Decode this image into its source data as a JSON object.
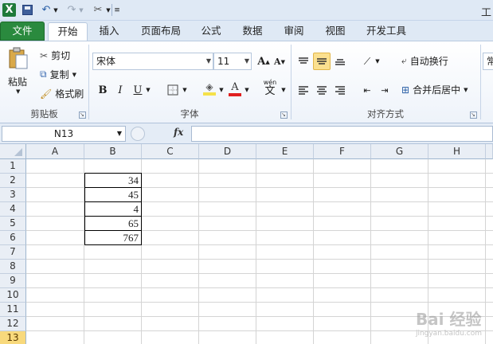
{
  "window": {
    "title": "工"
  },
  "quick_access": {
    "icons": [
      "excel-logo-icon",
      "save-icon",
      "undo-icon",
      "redo-icon",
      "customize-icon"
    ]
  },
  "tabs": [
    "文件",
    "开始",
    "插入",
    "页面布局",
    "公式",
    "数据",
    "审阅",
    "视图",
    "开发工具"
  ],
  "ribbon": {
    "clipboard": {
      "paste": "粘贴",
      "cut": "剪切",
      "copy": "复制",
      "format_painter": "格式刷",
      "label": "剪贴板"
    },
    "font": {
      "font_name": "宋体",
      "font_size": "11",
      "label": "字体",
      "bold": "B",
      "italic": "I",
      "underline": "U",
      "grow": "A",
      "shrink": "A",
      "wen": "wén",
      "wen_char": "文"
    },
    "alignment": {
      "wrap_text": "自动换行",
      "merge_center": "合并后居中",
      "label": "对齐方式"
    },
    "number": {
      "format_partial": "常"
    }
  },
  "formula_bar": {
    "name_box": "N13",
    "fx_label": "fx",
    "formula": ""
  },
  "sheet": {
    "columns": [
      "A",
      "B",
      "C",
      "D",
      "E",
      "F",
      "G",
      "H"
    ],
    "rows": [
      "1",
      "2",
      "3",
      "4",
      "5",
      "6",
      "7",
      "8",
      "9",
      "10",
      "11",
      "12",
      "13"
    ],
    "selected_row": "13",
    "b_values": [
      "34",
      "45",
      "4",
      "65",
      "767"
    ]
  },
  "watermark": {
    "main": "Bai 经验",
    "sub": "jingyan.baidu.com"
  },
  "colors": {
    "file_tab": "#2a8a3e",
    "active_align": "#fbe08f",
    "font_color": "#e02020",
    "highlight": "#f5e14a"
  }
}
